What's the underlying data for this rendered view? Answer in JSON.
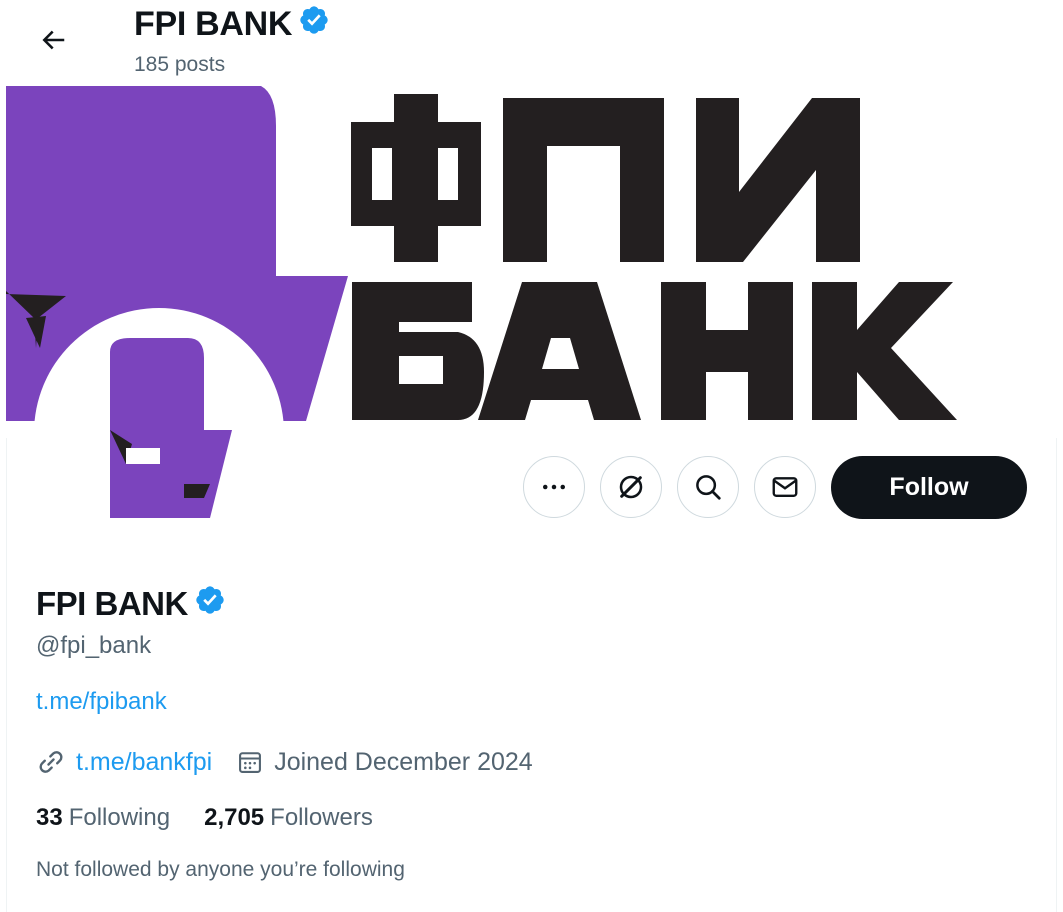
{
  "header": {
    "title": "FPI BANK",
    "posts": "185 posts"
  },
  "banner": {
    "line1": "ФПИ",
    "line2": "БАНК",
    "brand_colors": {
      "purple": "#7b44bd",
      "black": "#231f20"
    }
  },
  "actions": {
    "more_icon": "more-horizontal-icon",
    "grok_icon": "grok-icon",
    "search_icon": "search-icon",
    "message_icon": "mail-icon",
    "follow_label": "Follow"
  },
  "profile": {
    "display_name": "FPI BANK",
    "verified": true,
    "handle": "@fpi_bank",
    "bio_link": "t.me/fpibank",
    "website": "t.me/bankfpi",
    "joined": "Joined December 2024",
    "following_count": "33",
    "following_label": "Following",
    "followers_count": "2,705",
    "followers_label": "Followers",
    "followed_by": "Not followed by anyone you’re following"
  },
  "colors": {
    "accent": "#1d9bf0",
    "text": "#0f1419",
    "muted": "#536471",
    "border": "#cfd9de"
  }
}
